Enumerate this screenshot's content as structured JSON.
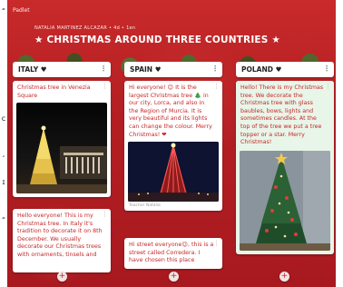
{
  "app": {
    "name": "Padlet"
  },
  "board": {
    "author": "NATALIA MARTINEZ ALCAZAR • 4d • 1en",
    "title": "★ CHRISTMAS AROUND THREE COUNTRIES ★"
  },
  "columns": [
    {
      "header": "ITALY ♥",
      "cards": [
        {
          "text": "Christmas tree in Venezia Square"
        },
        {
          "text": "Hello everyone! This is my Christmas tree. In Italy it's tradition to decorate it on 8th December. We usually decorate our Christmas trees with ornaments, tinsels and"
        }
      ]
    },
    {
      "header": "SPAIN ♥",
      "cards": [
        {
          "text": "Hi everyone! 😉 It is the largest Christmas tree 🎄 in our city, Lorca, and also in the Region of Murcia. It is very beautiful and its lights can change the colour. Merry Christmas! ❤",
          "caption": "Teacher Natalia"
        },
        {
          "text": "Hi street everyone😉, this is a street called Corredera. I have chosen this place"
        }
      ]
    },
    {
      "header": "POLAND ♥",
      "cards": [
        {
          "text": "Hello! There is my Christmas tree. We decorate the Christmas tree with glass baubles, bows, lights and sometimes candles. At the top of the tree we put a tree topper or a star. Merry Christmas!"
        }
      ]
    }
  ],
  "icons": {
    "menu": "⋮",
    "add": "+"
  },
  "side_marks": [
    "“",
    "c",
    "ʻ",
    "ɪ",
    "“"
  ],
  "colors": {
    "board_bg": "#b31f23",
    "card_text": "#c62828",
    "poland_card_bg": "#e8f5e9"
  }
}
